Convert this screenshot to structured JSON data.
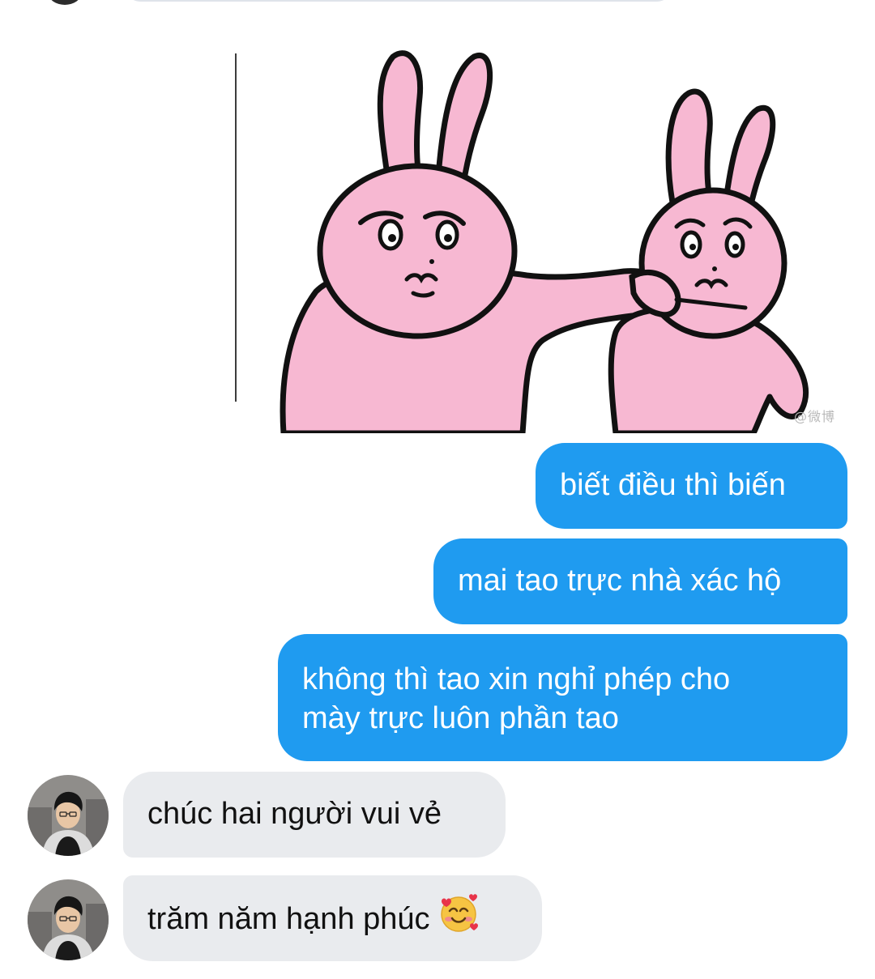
{
  "conversation": {
    "messages": [
      {
        "sender": "me",
        "type": "sticker",
        "sticker_name": "pink-rabbits-pushing-sticker",
        "watermark": "@微博"
      },
      {
        "sender": "me",
        "type": "text",
        "lines": [
          "biết điều thì biến"
        ]
      },
      {
        "sender": "me",
        "type": "text",
        "lines": [
          "mai tao trực nhà xác hộ"
        ]
      },
      {
        "sender": "me",
        "type": "text",
        "lines": [
          "không thì tao xin nghỉ phép cho",
          "mày trực luôn phần tao"
        ]
      },
      {
        "sender": "other",
        "type": "text",
        "lines": [
          "chúc hai người vui vẻ"
        ]
      },
      {
        "sender": "other",
        "type": "text",
        "lines": [
          "trăm năm hạnh phúc"
        ],
        "emoji": "smiling-face-with-hearts-icon"
      }
    ]
  },
  "colors": {
    "outgoing_bubble": "#1f9bf0",
    "incoming_bubble": "#e9ebee",
    "outgoing_text": "#ffffff",
    "incoming_text": "#111111",
    "sticker_pink": "#f7b8d2"
  }
}
